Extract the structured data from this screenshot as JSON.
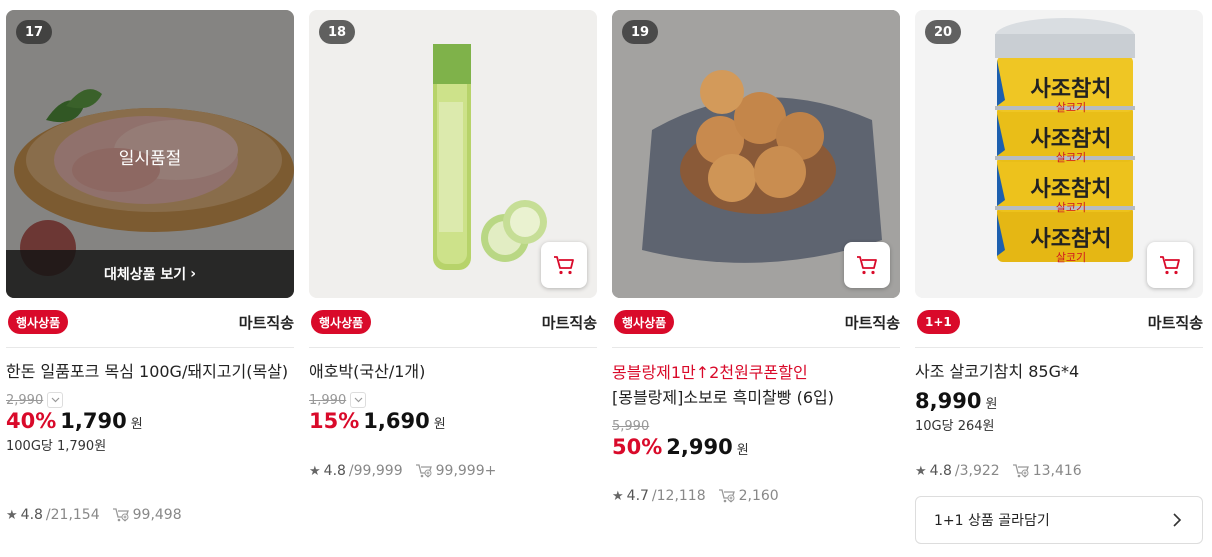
{
  "products": [
    {
      "rank": "17",
      "image": "pork-neck-meat",
      "soldout_label": "일시품절",
      "alt_button": "대체상품 보기",
      "badge": "행사상품",
      "shipping": "마트직송",
      "title": "한돈 일품포크 목심 100G/돼지고기(목살)",
      "original_price": "2,990",
      "discount": "40%",
      "price": "1,790",
      "won": "원",
      "unit_price": "100G당 1,790원",
      "rating": "4.8",
      "reviews": "/21,154",
      "cart_count": "99,498"
    },
    {
      "rank": "18",
      "image": "zucchini",
      "badge": "행사상품",
      "shipping": "마트직송",
      "title": "애호박(국산/1개)",
      "original_price": "1,990",
      "discount": "15%",
      "price": "1,690",
      "won": "원",
      "rating": "4.8",
      "reviews": "/99,999",
      "cart_count": "99,999+"
    },
    {
      "rank": "19",
      "image": "sweet-rice-bread",
      "badge": "행사상품",
      "shipping": "마트직송",
      "promo": "몽블랑제1만↑2천원쿠폰할인",
      "title": "[몽블랑제]소보로 흑미찰빵 (6입)",
      "original_price": "5,990",
      "discount": "50%",
      "price": "2,990",
      "won": "원",
      "rating": "4.7",
      "reviews": "/12,118",
      "cart_count": "2,160"
    },
    {
      "rank": "20",
      "image": "tuna-cans",
      "badge": "1+1",
      "shipping": "마트직송",
      "title": "사조 살코기참치 85G*4",
      "price": "8,990",
      "won": "원",
      "unit_price": "10G당 264원",
      "rating": "4.8",
      "reviews": "/3,922",
      "cart_count": "13,416",
      "plus_button": "1+1 상품 골라담기",
      "can_label_main": "사조참치",
      "can_label_sub": "살코기"
    }
  ],
  "colors": {
    "accent": "#d90a2a",
    "muted": "#888888"
  }
}
